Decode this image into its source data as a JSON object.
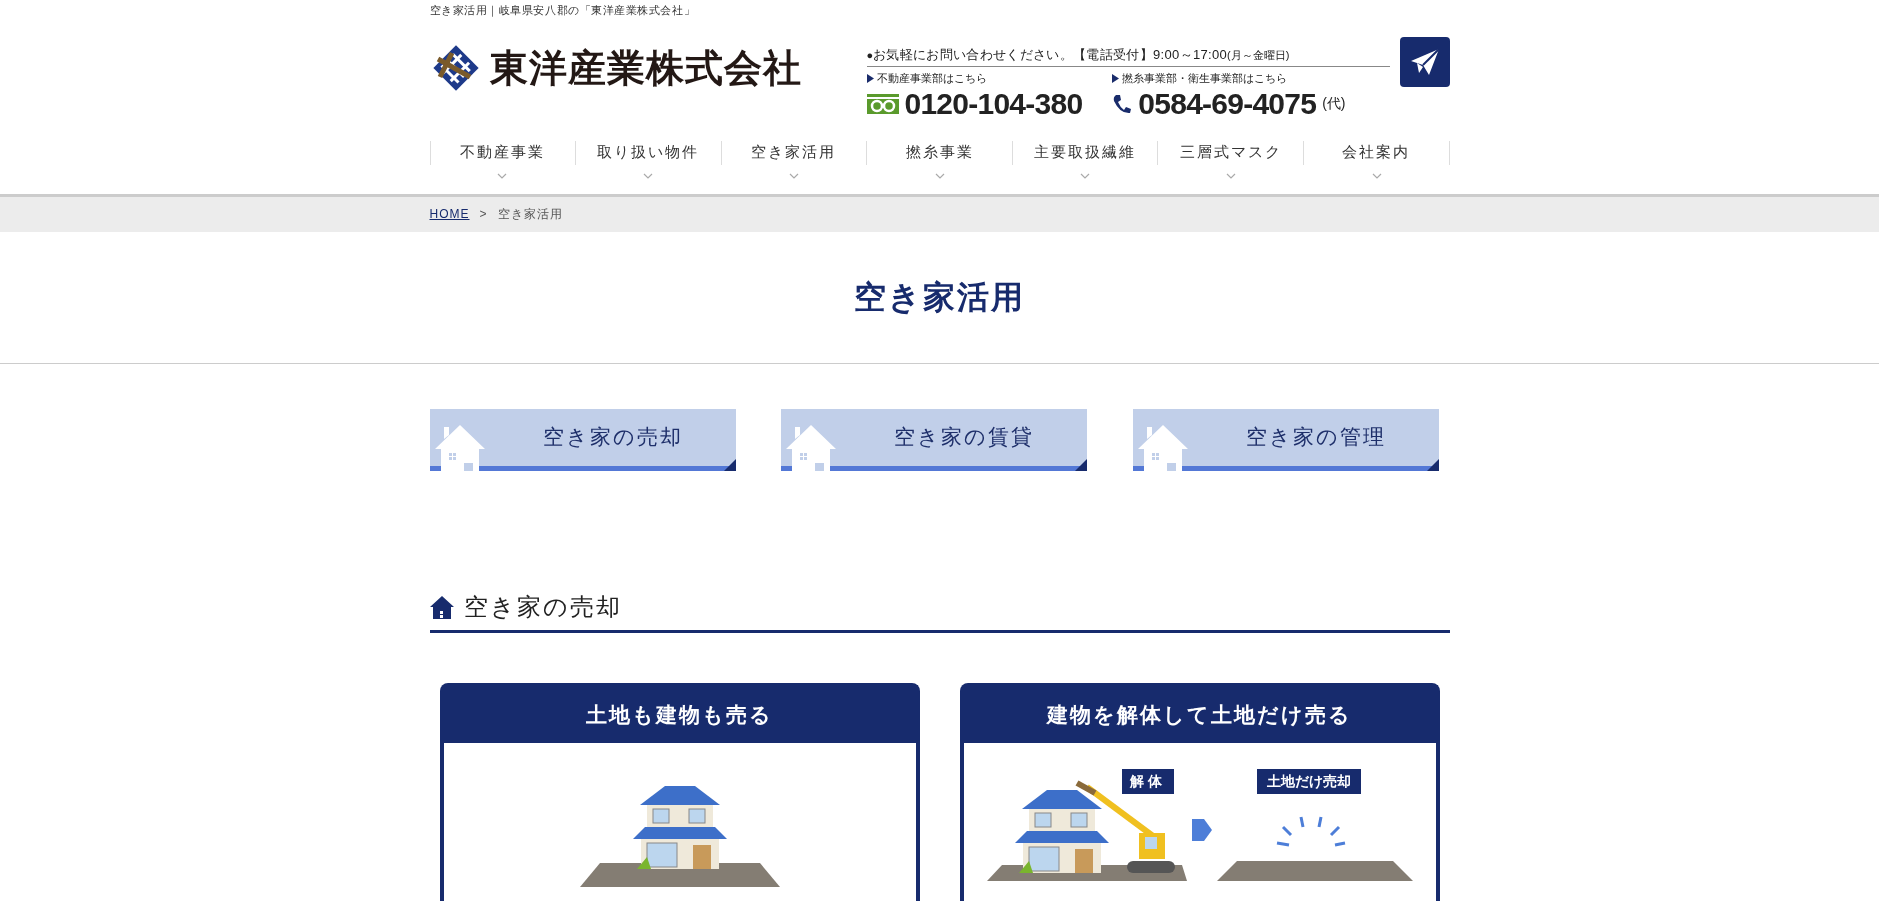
{
  "tagline": "空き家活用｜岐阜県安八郡の「東洋産業株式会社」",
  "logo": {
    "text": "東洋産業株式会社"
  },
  "contact": {
    "bullet": "●",
    "note": "お気軽にお問い合わせください。【電話受付】9:00～17:00",
    "note_small": "(月～金曜日)",
    "phones": [
      {
        "kind": "freedial",
        "label": "不動産事業部はこちら",
        "number": "0120-104-380"
      },
      {
        "kind": "phone",
        "label": "撚糸事業部・衛生事業部はこちら",
        "number": "0584-69-4075",
        "suffix": "(代)"
      }
    ]
  },
  "nav": [
    {
      "label": "不動産事業"
    },
    {
      "label": "取り扱い物件"
    },
    {
      "label": "空き家活用"
    },
    {
      "label": "撚糸事業"
    },
    {
      "label": "主要取扱繊維"
    },
    {
      "label": "三層式マスク"
    },
    {
      "label": "会社案内"
    }
  ],
  "breadcrumb": {
    "home": "HOME",
    "separator": ">",
    "current": "空き家活用"
  },
  "page_title": "空き家活用",
  "menu_buttons": [
    {
      "label": "空き家の売却"
    },
    {
      "label": "空き家の賃貸"
    },
    {
      "label": "空き家の管理"
    }
  ],
  "section": {
    "title": "空き家の売却",
    "cards": [
      {
        "kind": "house",
        "title": "土地も建物も売る"
      },
      {
        "kind": "demolition",
        "title": "建物を解体して土地だけ売る",
        "callouts": [
          "解体",
          "土地だけ売却"
        ]
      }
    ]
  }
}
